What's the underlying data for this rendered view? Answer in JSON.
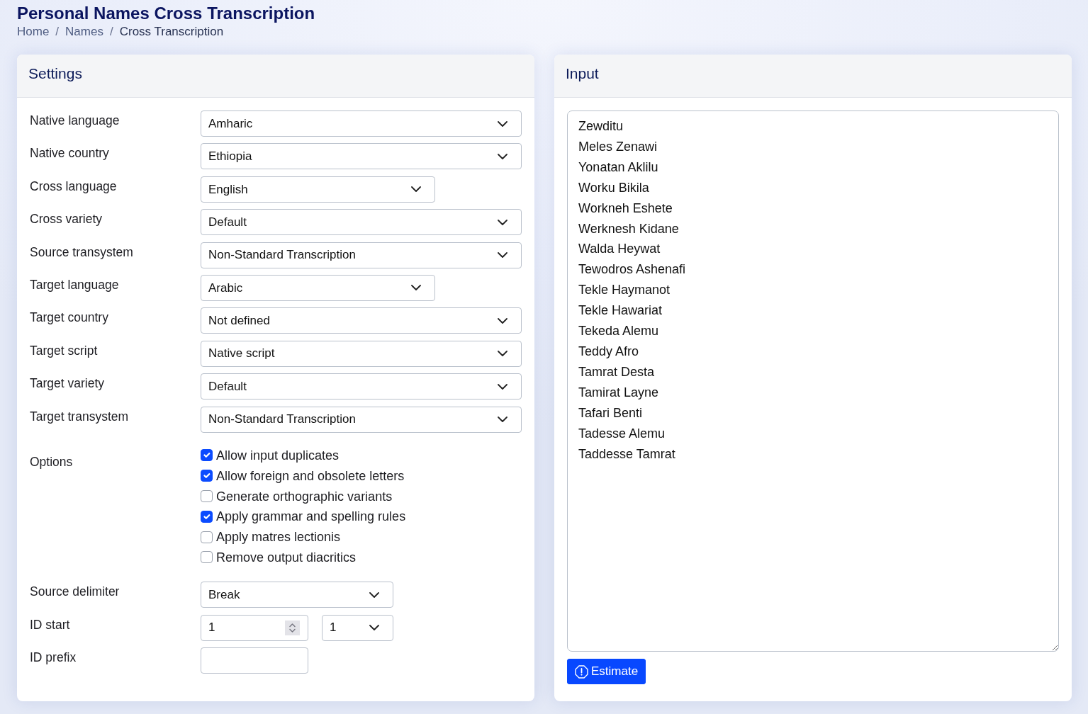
{
  "page": {
    "title": "Personal Names Cross Transcription"
  },
  "breadcrumb": {
    "separator": "/",
    "items": [
      {
        "label": "Home",
        "current": false
      },
      {
        "label": "Names",
        "current": false
      },
      {
        "label": "Cross Transcription",
        "current": true
      }
    ]
  },
  "settings": {
    "title": "Settings",
    "rows": [
      {
        "label": "Native language",
        "controls": [
          {
            "kind": "select",
            "value": "Amharic"
          }
        ]
      },
      {
        "label": "Native country",
        "controls": [
          {
            "kind": "select",
            "value": "Ethiopia"
          }
        ]
      },
      {
        "label": "Cross language",
        "controls": [
          {
            "kind": "select",
            "value": "English"
          }
        ]
      },
      {
        "label": "Cross variety",
        "controls": [
          {
            "kind": "select",
            "value": "Default"
          }
        ]
      },
      {
        "label": "Source transystem",
        "controls": [
          {
            "kind": "select",
            "value": "Non-Standard Transcription"
          }
        ]
      },
      {
        "label": "Target language",
        "controls": [
          {
            "kind": "select",
            "value": "Arabic"
          }
        ]
      },
      {
        "label": "Target country",
        "controls": [
          {
            "kind": "select",
            "value": "Not defined"
          }
        ]
      },
      {
        "label": "Target script",
        "controls": [
          {
            "kind": "select",
            "value": "Native script"
          }
        ]
      },
      {
        "label": "Target variety",
        "controls": [
          {
            "kind": "select",
            "value": "Default"
          }
        ]
      },
      {
        "label": "Target transystem",
        "controls": [
          {
            "kind": "select",
            "value": "Non-Standard Transcription"
          }
        ]
      },
      {
        "label": "Options",
        "controls": [
          {
            "kind": "checkbox",
            "label": "Allow input duplicates",
            "checked": true
          },
          {
            "kind": "checkbox",
            "label": "Allow foreign and obsolete letters",
            "checked": true
          },
          {
            "kind": "checkbox",
            "label": "Generate orthographic variants",
            "checked": false
          },
          {
            "kind": "checkbox",
            "label": "Apply grammar and spelling rules",
            "checked": true
          },
          {
            "kind": "checkbox",
            "label": "Apply matres lectionis",
            "checked": false
          },
          {
            "kind": "checkbox",
            "label": "Remove output diacritics",
            "checked": false
          }
        ]
      },
      {
        "label": "Source delimiter",
        "controls": [
          {
            "kind": "select",
            "value": "Break"
          }
        ]
      },
      {
        "label": "ID start",
        "controls": [
          {
            "kind": "number",
            "value": "1"
          },
          {
            "kind": "select",
            "value": "1"
          }
        ]
      },
      {
        "label": "ID prefix",
        "controls": [
          {
            "kind": "text"
          }
        ]
      }
    ]
  },
  "input": {
    "title": "Input",
    "lines": [
      "Zewditu",
      "Meles Zenawi",
      "Yonatan Aklilu",
      "Worku Bikila",
      "Workneh Eshete",
      "Werknesh Kidane",
      "Walda Heywat",
      "Tewodros Ashenafi",
      "Tekle Haymanot",
      "Tekle Hawariat",
      "Tekeda Alemu",
      "Teddy Afro",
      "Tamrat Desta",
      "Tamirat Layne",
      "Tafari Benti",
      "Tadesse Alemu",
      "Taddesse Tamrat"
    ],
    "button": {
      "label": "Estimate"
    }
  }
}
